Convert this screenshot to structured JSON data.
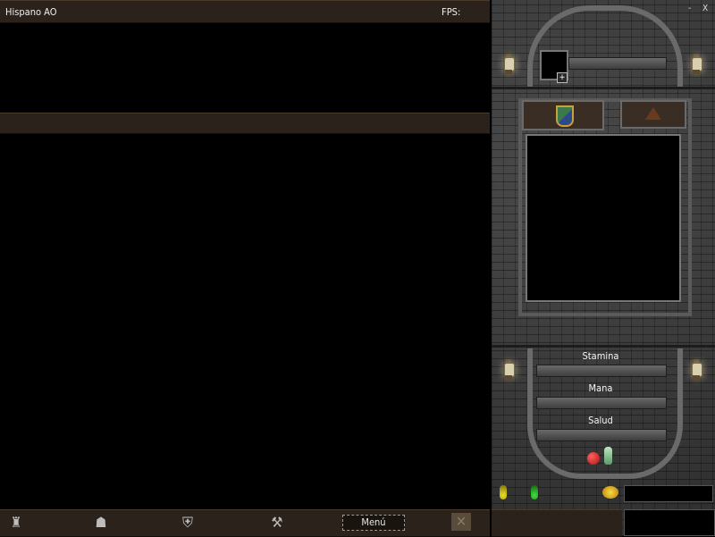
{
  "window": {
    "title": "Hispano AO",
    "fps_label": "FPS:",
    "minimize": "-",
    "close": "X"
  },
  "stats": {
    "stamina_label": "Stamina",
    "mana_label": "Mana",
    "salud_label": "Salud"
  },
  "bottombar": {
    "menu_label": "Menú"
  },
  "icons": {
    "shield_tab": "shield-icon",
    "hat_tab": "wizard-hat-icon",
    "apple": "apple-icon",
    "water": "water-bottle-icon",
    "potion_yellow": "yellow-potion-icon",
    "potion_green": "green-potion-icon",
    "gold": "gold-coins-icon",
    "add": "plus-icon"
  },
  "colors": {
    "bar_brown": "#2a221b",
    "stone": "#3c3c3c"
  }
}
